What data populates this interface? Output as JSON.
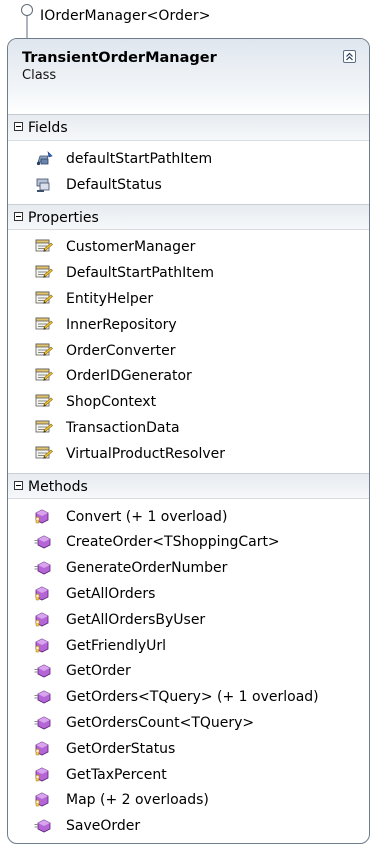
{
  "interface": {
    "label": "IOrderManager<Order>"
  },
  "class": {
    "name": "TransientOrderManager",
    "stereotype": "Class"
  },
  "sections": [
    {
      "title": "Fields",
      "items": [
        {
          "label": "defaultStartPathItem",
          "icon": "private-field-icon"
        },
        {
          "label": "DefaultStatus",
          "icon": "field-icon"
        }
      ]
    },
    {
      "title": "Properties",
      "items": [
        {
          "label": "CustomerManager",
          "icon": "property-icon"
        },
        {
          "label": "DefaultStartPathItem",
          "icon": "property-icon"
        },
        {
          "label": "EntityHelper",
          "icon": "property-icon"
        },
        {
          "label": "InnerRepository",
          "icon": "property-icon"
        },
        {
          "label": "OrderConverter",
          "icon": "property-icon"
        },
        {
          "label": "OrderIDGenerator",
          "icon": "property-icon"
        },
        {
          "label": "ShopContext",
          "icon": "property-icon"
        },
        {
          "label": "TransactionData",
          "icon": "property-icon"
        },
        {
          "label": "VirtualProductResolver",
          "icon": "property-icon"
        }
      ]
    },
    {
      "title": "Methods",
      "items": [
        {
          "label": "Convert (+ 1 overload)",
          "icon": "public-method-icon"
        },
        {
          "label": "CreateOrder<TShoppingCart>",
          "icon": "protected-method-icon"
        },
        {
          "label": "GenerateOrderNumber",
          "icon": "protected-method-icon"
        },
        {
          "label": "GetAllOrders",
          "icon": "public-method-icon"
        },
        {
          "label": "GetAllOrdersByUser",
          "icon": "public-method-icon"
        },
        {
          "label": "GetFriendlyUrl",
          "icon": "public-method-icon"
        },
        {
          "label": "GetOrder",
          "icon": "protected-method-icon"
        },
        {
          "label": "GetOrders<TQuery> (+ 1 overload)",
          "icon": "protected-method-icon"
        },
        {
          "label": "GetOrdersCount<TQuery>",
          "icon": "protected-method-icon"
        },
        {
          "label": "GetOrderStatus",
          "icon": "public-method-icon"
        },
        {
          "label": "GetTaxPercent",
          "icon": "public-method-icon"
        },
        {
          "label": "Map (+ 2 overloads)",
          "icon": "public-method-icon"
        },
        {
          "label": "SaveOrder",
          "icon": "protected-method-icon"
        }
      ]
    }
  ]
}
